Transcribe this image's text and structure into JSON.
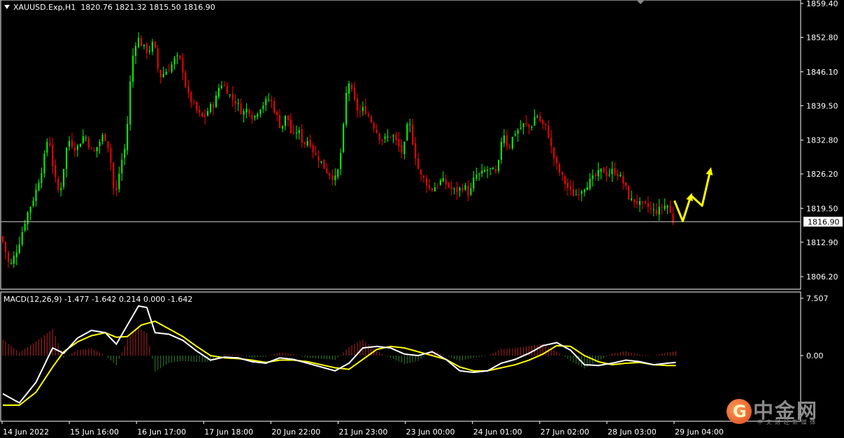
{
  "header": {
    "symbol": "XAUUSD.Exp,H1",
    "ohlc": "1820.76 1821.32 1815.50 1816.90"
  },
  "macd_header": "MACD(12,26,9) -1.477 -1.642 0.214 0.000 -1.642",
  "current_price_label": "1816.90",
  "colors": {
    "bull": "#00ff00",
    "bear": "#ff0000",
    "macd_line": "#ffffff",
    "signal_line": "#ffff00",
    "hist_pos": "#b22222",
    "hist_neg": "#2e7d32",
    "arrow": "#ffff00",
    "axis": "#ffffff"
  },
  "logo": {
    "text": "中金网",
    "sub": "中 文 财 经 新 媒 体",
    "site": "CNGOLD.ORG.CN"
  },
  "chart_data": [
    {
      "type": "candlestick",
      "title": "XAUUSD.Exp,H1",
      "ylim": [
        1802.0,
        1860.0
      ],
      "y_ticks": [
        "1859.40",
        "1852.80",
        "1846.10",
        "1839.50",
        "1832.80",
        "1826.20",
        "1819.50",
        "1812.90",
        "1806.20"
      ],
      "x_ticks": [
        "14 Jun 2022",
        "15 Jun 16:00",
        "16 Jun 17:00",
        "17 Jun 18:00",
        "20 Jun 22:00",
        "21 Jun 23:00",
        "23 Jun 00:00",
        "24 Jun 01:00",
        "27 Jun 02:00",
        "28 Jun 03:00",
        "29 Jun 04:00"
      ],
      "current_price": 1816.9,
      "anchors": [
        [
          0,
          1814
        ],
        [
          3,
          1808
        ],
        [
          6,
          1812
        ],
        [
          9,
          1818
        ],
        [
          12,
          1822
        ],
        [
          15,
          1828
        ],
        [
          17,
          1834
        ],
        [
          19,
          1826
        ],
        [
          21,
          1822
        ],
        [
          24,
          1833
        ],
        [
          27,
          1831
        ],
        [
          30,
          1834
        ],
        [
          33,
          1830
        ],
        [
          35,
          1832
        ],
        [
          37,
          1834
        ],
        [
          39,
          1831
        ],
        [
          41,
          1821
        ],
        [
          43,
          1828
        ],
        [
          45,
          1832
        ],
        [
          47,
          1848
        ],
        [
          49,
          1853
        ],
        [
          51,
          1851
        ],
        [
          53,
          1850
        ],
        [
          55,
          1852
        ],
        [
          57,
          1845
        ],
        [
          59,
          1846
        ],
        [
          61,
          1847
        ],
        [
          63,
          1849
        ],
        [
          65,
          1848
        ],
        [
          67,
          1842
        ],
        [
          69,
          1840
        ],
        [
          71,
          1838
        ],
        [
          73,
          1837
        ],
        [
          75,
          1839
        ],
        [
          77,
          1840
        ],
        [
          79,
          1844
        ],
        [
          81,
          1843
        ],
        [
          83,
          1841
        ],
        [
          85,
          1840
        ],
        [
          87,
          1838
        ],
        [
          89,
          1839
        ],
        [
          91,
          1837
        ],
        [
          93,
          1839
        ],
        [
          95,
          1840
        ],
        [
          97,
          1841
        ],
        [
          99,
          1838
        ],
        [
          101,
          1835
        ],
        [
          103,
          1838
        ],
        [
          105,
          1833
        ],
        [
          107,
          1835
        ],
        [
          109,
          1832
        ],
        [
          111,
          1833
        ],
        [
          113,
          1830
        ],
        [
          115,
          1829
        ],
        [
          117,
          1827
        ],
        [
          119,
          1826
        ],
        [
          121,
          1825
        ],
        [
          123,
          1832
        ],
        [
          125,
          1845
        ],
        [
          127,
          1841
        ],
        [
          129,
          1838
        ],
        [
          131,
          1839
        ],
        [
          133,
          1837
        ],
        [
          135,
          1835
        ],
        [
          137,
          1833
        ],
        [
          139,
          1833
        ],
        [
          141,
          1834
        ],
        [
          143,
          1832
        ],
        [
          145,
          1830
        ],
        [
          147,
          1837
        ],
        [
          149,
          1831
        ],
        [
          151,
          1826
        ],
        [
          153,
          1825
        ],
        [
          155,
          1823
        ],
        [
          157,
          1824
        ],
        [
          159,
          1825
        ],
        [
          161,
          1824
        ],
        [
          163,
          1823
        ],
        [
          165,
          1823
        ],
        [
          167,
          1824
        ],
        [
          169,
          1822
        ],
        [
          171,
          1826
        ],
        [
          173,
          1826
        ],
        [
          175,
          1827
        ],
        [
          177,
          1827
        ],
        [
          179,
          1826
        ],
        [
          181,
          1835
        ],
        [
          183,
          1831
        ],
        [
          185,
          1834
        ],
        [
          187,
          1835
        ],
        [
          189,
          1836
        ],
        [
          191,
          1835
        ],
        [
          193,
          1838
        ],
        [
          195,
          1836
        ],
        [
          197,
          1835
        ],
        [
          199,
          1830
        ],
        [
          201,
          1827
        ],
        [
          203,
          1825
        ],
        [
          205,
          1823
        ],
        [
          207,
          1822
        ],
        [
          209,
          1823
        ],
        [
          211,
          1824
        ],
        [
          213,
          1825
        ],
        [
          215,
          1826
        ],
        [
          217,
          1827
        ],
        [
          219,
          1826
        ],
        [
          221,
          1827
        ],
        [
          223,
          1826
        ],
        [
          225,
          1824
        ],
        [
          227,
          1821
        ],
        [
          229,
          1821
        ],
        [
          231,
          1820
        ],
        [
          233,
          1820
        ],
        [
          235,
          1819
        ],
        [
          237,
          1819
        ],
        [
          239,
          1820
        ],
        [
          241,
          1820
        ],
        [
          242,
          1817
        ]
      ],
      "forecast_arrows": [
        [
          [
            243,
            1821
          ],
          [
            246,
            1817
          ],
          [
            249,
            1822
          ]
        ],
        [
          [
            249,
            1822
          ],
          [
            253,
            1820
          ],
          [
            256,
            1827
          ]
        ]
      ]
    },
    {
      "type": "macd",
      "title": "MACD(12,26,9)",
      "values": {
        "macd": -1.477,
        "signal": -1.642,
        "histogram": 0.214,
        "level": 0.0,
        "last": -1.642
      },
      "ylim": [
        -7.0,
        7.507
      ],
      "y_ticks": [
        "7.507",
        "0.00"
      ],
      "macd_anchors": [
        [
          0,
          -5.0
        ],
        [
          6,
          -6.2
        ],
        [
          12,
          -3.5
        ],
        [
          18,
          1.0
        ],
        [
          22,
          0.3
        ],
        [
          27,
          2.3
        ],
        [
          32,
          3.3
        ],
        [
          37,
          3.0
        ],
        [
          41,
          1.5
        ],
        [
          45,
          4.0
        ],
        [
          49,
          6.5
        ],
        [
          52,
          6.3
        ],
        [
          55,
          3.0
        ],
        [
          60,
          2.8
        ],
        [
          65,
          2.0
        ],
        [
          70,
          0.6
        ],
        [
          75,
          -0.6
        ],
        [
          80,
          -0.2
        ],
        [
          85,
          -0.3
        ],
        [
          90,
          -0.8
        ],
        [
          95,
          -1.0
        ],
        [
          100,
          -0.3
        ],
        [
          105,
          -0.5
        ],
        [
          110,
          -1.0
        ],
        [
          115,
          -1.5
        ],
        [
          120,
          -2.0
        ],
        [
          125,
          -1.0
        ],
        [
          130,
          1.0
        ],
        [
          135,
          1.2
        ],
        [
          140,
          1.0
        ],
        [
          145,
          0.2
        ],
        [
          150,
          0.0
        ],
        [
          155,
          0.5
        ],
        [
          160,
          -0.5
        ],
        [
          165,
          -2.0
        ],
        [
          170,
          -2.2
        ],
        [
          175,
          -2.0
        ],
        [
          180,
          -1.0
        ],
        [
          185,
          -0.5
        ],
        [
          190,
          0.3
        ],
        [
          195,
          1.3
        ],
        [
          200,
          1.7
        ],
        [
          205,
          0.7
        ],
        [
          210,
          -1.2
        ],
        [
          215,
          -1.3
        ],
        [
          220,
          -1.0
        ],
        [
          225,
          -0.6
        ],
        [
          230,
          -0.8
        ],
        [
          235,
          -1.2
        ],
        [
          240,
          -1.0
        ],
        [
          243,
          -0.9
        ]
      ],
      "signal_anchors": [
        [
          0,
          -6.5
        ],
        [
          6,
          -6.5
        ],
        [
          12,
          -4.8
        ],
        [
          18,
          -1.5
        ],
        [
          22,
          0.5
        ],
        [
          27,
          1.8
        ],
        [
          32,
          2.6
        ],
        [
          37,
          3.0
        ],
        [
          41,
          2.4
        ],
        [
          45,
          2.5
        ],
        [
          50,
          4.0
        ],
        [
          55,
          4.5
        ],
        [
          60,
          3.5
        ],
        [
          65,
          2.5
        ],
        [
          70,
          1.2
        ],
        [
          75,
          0.0
        ],
        [
          80,
          -0.3
        ],
        [
          85,
          -0.4
        ],
        [
          90,
          -0.6
        ],
        [
          95,
          -0.9
        ],
        [
          100,
          -0.6
        ],
        [
          105,
          -0.6
        ],
        [
          110,
          -0.8
        ],
        [
          115,
          -1.2
        ],
        [
          120,
          -1.6
        ],
        [
          125,
          -1.8
        ],
        [
          130,
          -0.5
        ],
        [
          135,
          0.8
        ],
        [
          140,
          1.2
        ],
        [
          145,
          1.0
        ],
        [
          150,
          0.5
        ],
        [
          155,
          0.0
        ],
        [
          160,
          -0.5
        ],
        [
          165,
          -1.5
        ],
        [
          170,
          -2.0
        ],
        [
          175,
          -2.0
        ],
        [
          180,
          -1.6
        ],
        [
          185,
          -1.2
        ],
        [
          190,
          -0.6
        ],
        [
          195,
          0.2
        ],
        [
          200,
          1.3
        ],
        [
          205,
          1.2
        ],
        [
          210,
          0.0
        ],
        [
          215,
          -0.8
        ],
        [
          220,
          -1.2
        ],
        [
          225,
          -1.0
        ],
        [
          230,
          -0.9
        ],
        [
          235,
          -1.2
        ],
        [
          240,
          -1.3
        ],
        [
          243,
          -1.3
        ]
      ]
    }
  ]
}
